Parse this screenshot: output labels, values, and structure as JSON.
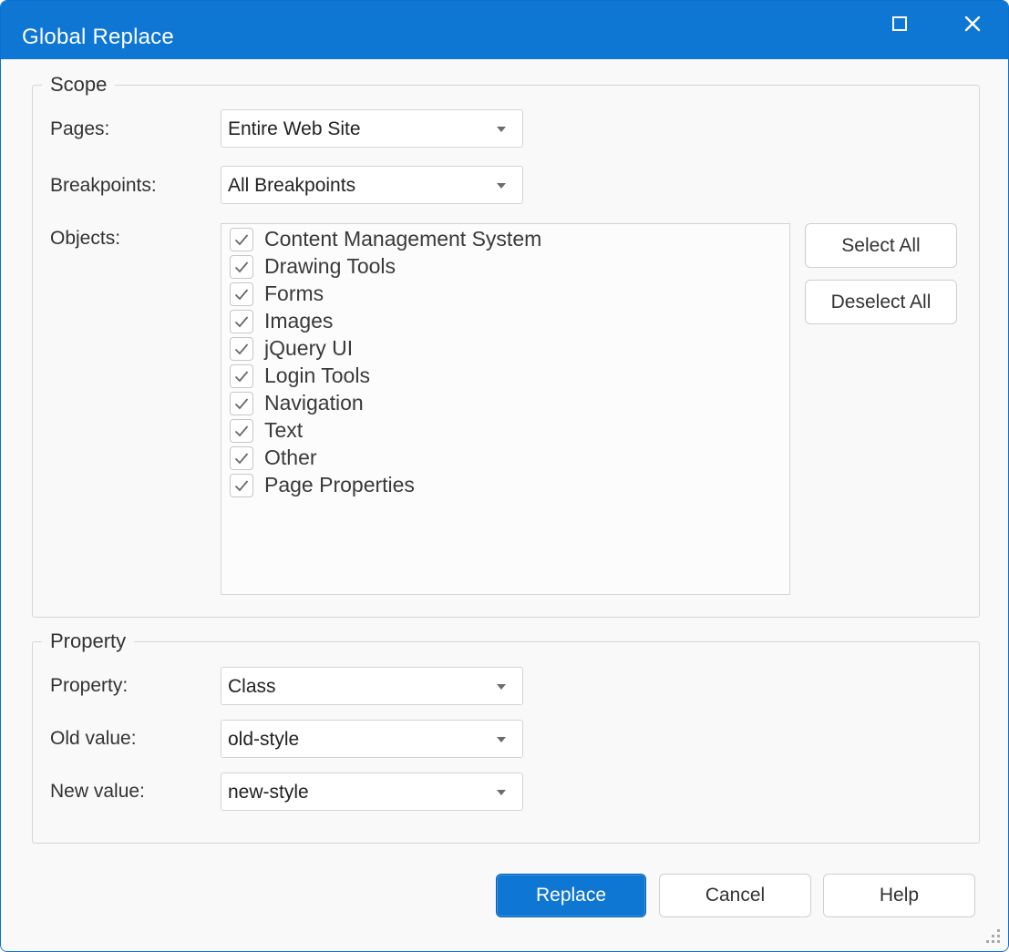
{
  "window": {
    "title": "Global Replace",
    "maximize_icon": "maximize-icon",
    "close_icon": "close-icon",
    "title_bar_color": "#0e76d3"
  },
  "scope": {
    "legend": "Scope",
    "pages_label": "Pages:",
    "pages_value": "Entire Web Site",
    "breakpoints_label": "Breakpoints:",
    "breakpoints_value": "All Breakpoints",
    "objects_label": "Objects:",
    "objects": [
      {
        "label": "Content Management System",
        "checked": true
      },
      {
        "label": "Drawing Tools",
        "checked": true
      },
      {
        "label": "Forms",
        "checked": true
      },
      {
        "label": "Images",
        "checked": true
      },
      {
        "label": "jQuery UI",
        "checked": true
      },
      {
        "label": "Login Tools",
        "checked": true
      },
      {
        "label": "Navigation",
        "checked": true
      },
      {
        "label": "Text",
        "checked": true
      },
      {
        "label": "Other",
        "checked": true
      },
      {
        "label": "Page Properties",
        "checked": true
      }
    ],
    "select_all_label": "Select All",
    "deselect_all_label": "Deselect All"
  },
  "property": {
    "legend": "Property",
    "property_label": "Property:",
    "property_value": "Class",
    "old_value_label": "Old value:",
    "old_value": "old-style",
    "new_value_label": "New value:",
    "new_value": "new-style"
  },
  "footer": {
    "replace_label": "Replace",
    "cancel_label": "Cancel",
    "help_label": "Help"
  }
}
